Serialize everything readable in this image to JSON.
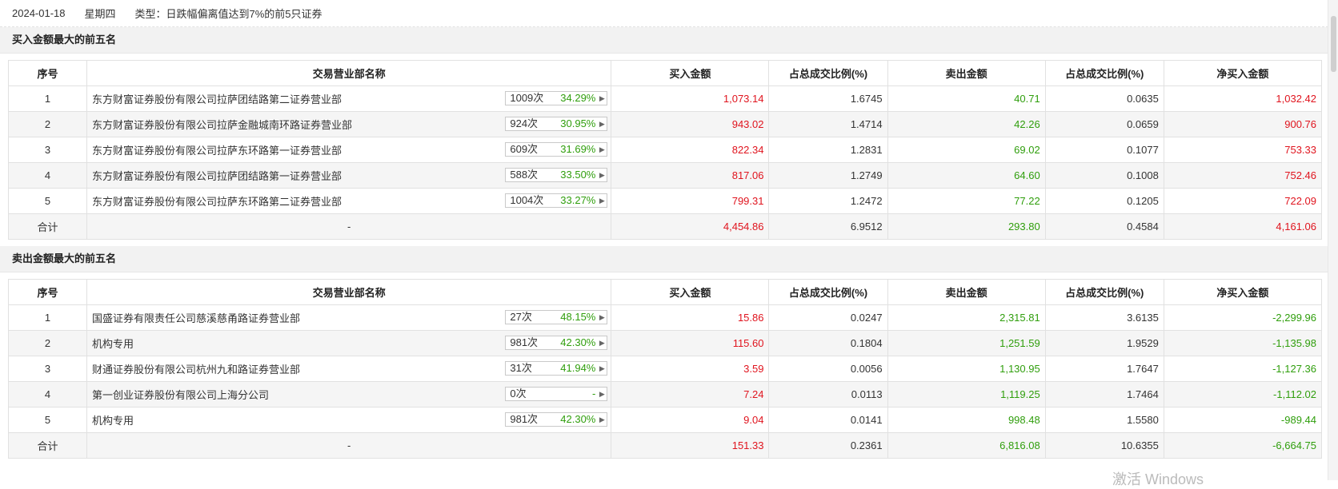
{
  "header": {
    "date": "2024-01-18",
    "weekday": "星期四",
    "type": "类型：日跌幅偏离值达到7%的前5只证券"
  },
  "columns": [
    "序号",
    "交易营业部名称",
    "买入金额",
    "占总成交比例(%)",
    "卖出金额",
    "占总成交比例(%)",
    "净买入金额"
  ],
  "buy_section": {
    "title": "买入金额最大的前五名",
    "rows": [
      {
        "no": "1",
        "name": "东方财富证券股份有限公司拉萨团结路第二证券营业部",
        "cnt": "1009次",
        "pct": "34.29%",
        "buy": "1,073.14",
        "buy_ratio": "1.6745",
        "sell": "40.71",
        "sell_ratio": "0.0635",
        "net": "1,032.42"
      },
      {
        "no": "2",
        "name": "东方财富证券股份有限公司拉萨金融城南环路证券营业部",
        "cnt": "924次",
        "pct": "30.95%",
        "buy": "943.02",
        "buy_ratio": "1.4714",
        "sell": "42.26",
        "sell_ratio": "0.0659",
        "net": "900.76"
      },
      {
        "no": "3",
        "name": "东方财富证券股份有限公司拉萨东环路第一证券营业部",
        "cnt": "609次",
        "pct": "31.69%",
        "buy": "822.34",
        "buy_ratio": "1.2831",
        "sell": "69.02",
        "sell_ratio": "0.1077",
        "net": "753.33"
      },
      {
        "no": "4",
        "name": "东方财富证券股份有限公司拉萨团结路第一证券营业部",
        "cnt": "588次",
        "pct": "33.50%",
        "buy": "817.06",
        "buy_ratio": "1.2749",
        "sell": "64.60",
        "sell_ratio": "0.1008",
        "net": "752.46"
      },
      {
        "no": "5",
        "name": "东方财富证券股份有限公司拉萨东环路第二证券营业部",
        "cnt": "1004次",
        "pct": "33.27%",
        "buy": "799.31",
        "buy_ratio": "1.2472",
        "sell": "77.22",
        "sell_ratio": "0.1205",
        "net": "722.09"
      }
    ],
    "total": {
      "label": "合计",
      "name": "-",
      "buy": "4,454.86",
      "buy_ratio": "6.9512",
      "sell": "293.80",
      "sell_ratio": "0.4584",
      "net": "4,161.06"
    }
  },
  "sell_section": {
    "title": "卖出金额最大的前五名",
    "rows": [
      {
        "no": "1",
        "name": "国盛证券有限责任公司慈溪慈甬路证券营业部",
        "cnt": "27次",
        "pct": "48.15%",
        "buy": "15.86",
        "buy_ratio": "0.0247",
        "sell": "2,315.81",
        "sell_ratio": "3.6135",
        "net": "-2,299.96"
      },
      {
        "no": "2",
        "name": "机构专用",
        "cnt": "981次",
        "pct": "42.30%",
        "buy": "115.60",
        "buy_ratio": "0.1804",
        "sell": "1,251.59",
        "sell_ratio": "1.9529",
        "net": "-1,135.98"
      },
      {
        "no": "3",
        "name": "财通证券股份有限公司杭州九和路证券营业部",
        "cnt": "31次",
        "pct": "41.94%",
        "buy": "3.59",
        "buy_ratio": "0.0056",
        "sell": "1,130.95",
        "sell_ratio": "1.7647",
        "net": "-1,127.36"
      },
      {
        "no": "4",
        "name": "第一创业证券股份有限公司上海分公司",
        "cnt": "0次",
        "pct": "-",
        "buy": "7.24",
        "buy_ratio": "0.0113",
        "sell": "1,119.25",
        "sell_ratio": "1.7464",
        "net": "-1,112.02"
      },
      {
        "no": "5",
        "name": "机构专用",
        "cnt": "981次",
        "pct": "42.30%",
        "buy": "9.04",
        "buy_ratio": "0.0141",
        "sell": "998.48",
        "sell_ratio": "1.5580",
        "net": "-989.44"
      }
    ],
    "total": {
      "label": "合计",
      "name": "-",
      "buy": "151.33",
      "buy_ratio": "0.2361",
      "sell": "6,816.08",
      "sell_ratio": "10.6355",
      "net": "-6,664.75"
    }
  },
  "watermark": "激活 Windows",
  "colors": {
    "buy": "#e0141e",
    "sell": "#2f9e0c",
    "net_positive": "#e0141e",
    "net_negative": "#2f9e0c"
  }
}
